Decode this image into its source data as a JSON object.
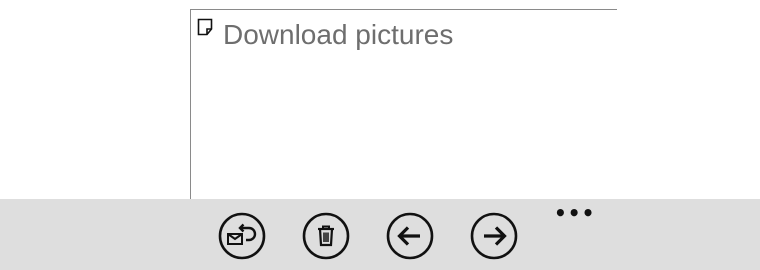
{
  "note": {
    "title": "Download pictures",
    "icon": "note-icon"
  },
  "app_bar": {
    "buttons": [
      {
        "name": "reply",
        "icon": "reply-icon"
      },
      {
        "name": "delete",
        "icon": "trash-icon"
      },
      {
        "name": "previous",
        "icon": "arrow-left-icon"
      },
      {
        "name": "next",
        "icon": "arrow-right-icon"
      }
    ],
    "more_label": "•••"
  },
  "colors": {
    "app_bar_background": "#dedede",
    "title_text": "#6e6e6e",
    "icon_stroke": "#111111",
    "panel_border": "#8a8a8a"
  }
}
